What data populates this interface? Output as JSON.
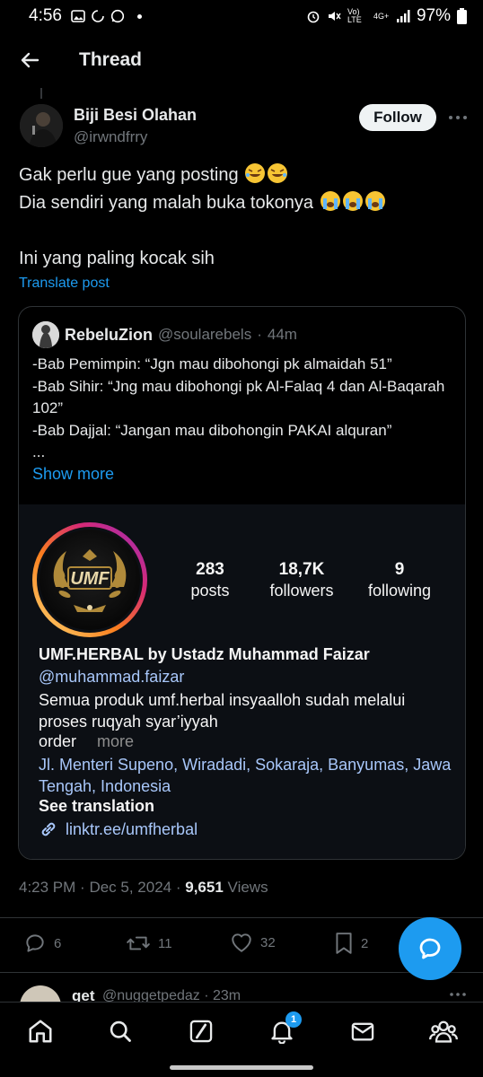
{
  "status_bar": {
    "time": "4:56",
    "battery": "97%",
    "network_lte": "Vo) LTE",
    "network_4g": "4G+"
  },
  "header": {
    "title": "Thread"
  },
  "post": {
    "author_name": "Biji Besi Olahan",
    "author_handle": "@irwndfrry",
    "follow_label": "Follow",
    "line1": "Gak perlu gue yang posting",
    "line2": "Dia sendiri yang malah buka tokonya",
    "line3": "Ini yang paling kocak sih",
    "translate_label": "Translate post",
    "time": "4:23 PM",
    "date": "Dec 5, 2024",
    "views_count": "9,651",
    "views_label": "Views",
    "stats": {
      "replies": "6",
      "reposts": "11",
      "likes": "32",
      "bookmarks": "2"
    }
  },
  "quote": {
    "name": "RebeluZion",
    "handle": "@soularebels",
    "age": "44m",
    "lines": [
      "-Bab Pemimpin: “Jgn mau dibohongi pk almaidah 51”",
      "-Bab Sihir: “Jng mau dibohongi pk Al-Falaq 4 dan Al-Baqarah 102”",
      "-Bab Dajjal: “Jangan mau dibohongin PAKAI alquran”",
      "..."
    ],
    "show_more": "Show more"
  },
  "instagram": {
    "logo_text": "UMF",
    "posts_count": "283",
    "posts_label": "posts",
    "followers_count": "18,7K",
    "followers_label": "followers",
    "following_count": "9",
    "following_label": "following",
    "profile_name": "UMF.HERBAL by Ustadz Muhammad Faizar",
    "username": "@muhammad.faizar",
    "bio": "Semua produk umf.herbal insyaalloh sudah melalui proses ruqyah syar’iyyah",
    "order": "order",
    "more": "more",
    "address": "Jl. Menteri Supeno, Wiradadi, Sokaraja, Banyumas, Jawa Tengah, Indonesia",
    "see_translation": "See translation",
    "link": "linktr.ee/umfherbal"
  },
  "next_reply": {
    "name": "get",
    "handle": "@nuggetpedaz · 23m"
  },
  "nav": {
    "notification_badge": "1"
  },
  "colors": {
    "accent": "#1d9bf0",
    "background": "#000000",
    "muted": "#71767b",
    "ig_link": "#a8c7fa"
  }
}
